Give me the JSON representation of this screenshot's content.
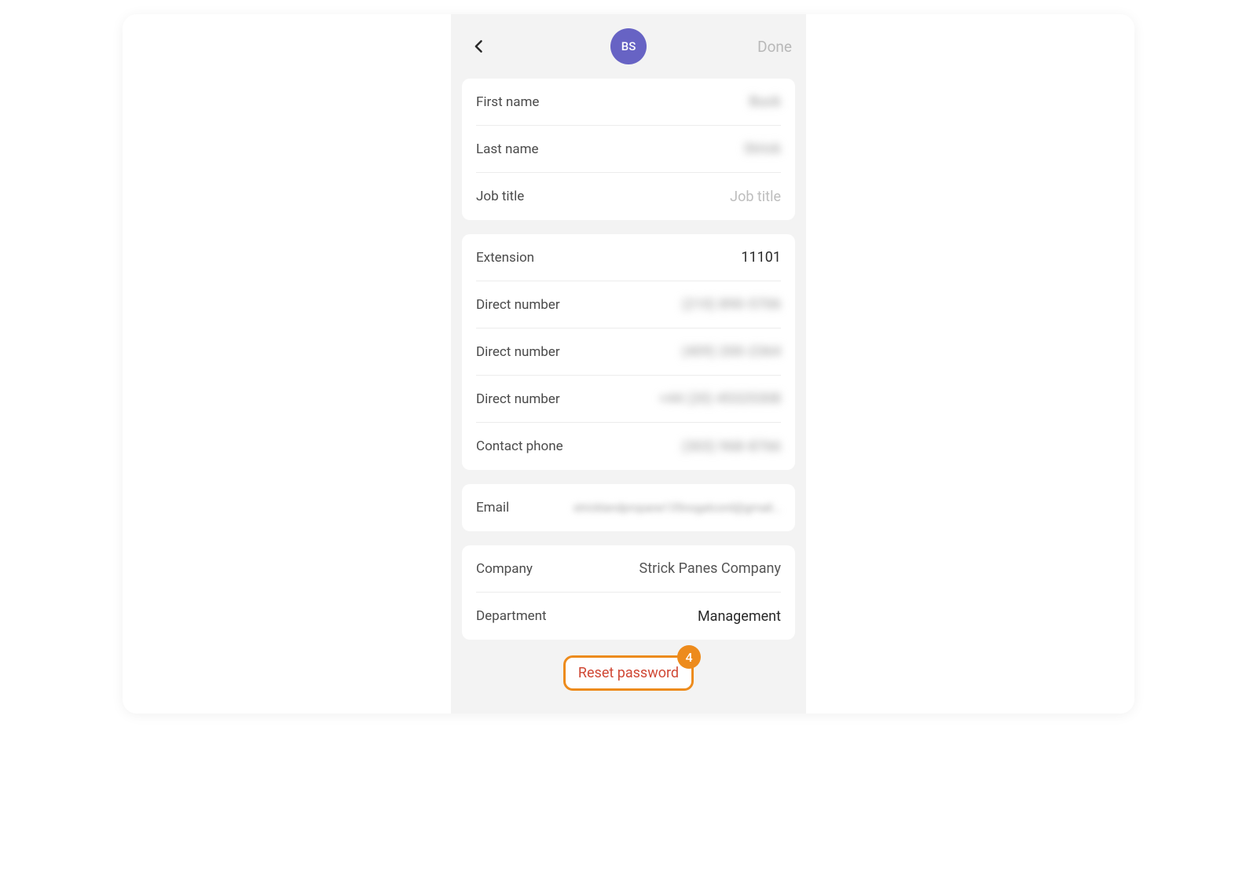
{
  "header": {
    "avatar_initials": "BS",
    "done_label": "Done"
  },
  "name_card": {
    "first_name_label": "First name",
    "first_name_value": "Buck",
    "last_name_label": "Last name",
    "last_name_value": "Strick",
    "job_title_label": "Job title",
    "job_title_placeholder": "Job title"
  },
  "phone_card": {
    "extension_label": "Extension",
    "extension_value": "11101",
    "direct1_label": "Direct number",
    "direct1_value": "(210) 890-5706",
    "direct2_label": "Direct number",
    "direct2_value": "(409) 200-2364",
    "direct3_label": "Direct number",
    "direct3_value": "+44 (20) 45325308",
    "contact_label": "Contact phone",
    "contact_value": "(303) 968-8766"
  },
  "email_card": {
    "email_label": "Email",
    "email_value": "stricklandpropane135nogatcord@gmail..."
  },
  "company_card": {
    "company_label": "Company",
    "company_value": "Strick Panes Company",
    "department_label": "Department",
    "department_value": "Management"
  },
  "reset": {
    "label": "Reset password",
    "badge": "4"
  }
}
